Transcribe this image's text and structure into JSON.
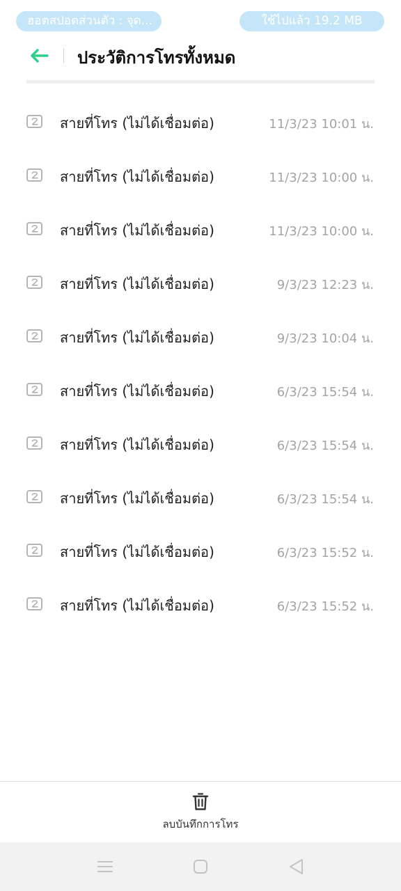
{
  "status_bar": {
    "left_pill": "ฮอตสปอตส่วนตัว : จุด...",
    "right_pill": "ใช้ไปแล้ว 19.2 MB"
  },
  "header": {
    "title": "ประวัติการโทรทั้งหมด",
    "back_icon": "arrow-left-icon",
    "accent_color": "#2ecf8b"
  },
  "calls": [
    {
      "label": "สายที่โทร (ไม่ได้เชื่อมต่อ)",
      "time": "11/3/23 10:01 น."
    },
    {
      "label": "สายที่โทร (ไม่ได้เชื่อมต่อ)",
      "time": "11/3/23 10:00 น."
    },
    {
      "label": "สายที่โทร (ไม่ได้เชื่อมต่อ)",
      "time": "11/3/23 10:00 น."
    },
    {
      "label": "สายที่โทร (ไม่ได้เชื่อมต่อ)",
      "time": "9/3/23 12:23 น."
    },
    {
      "label": "สายที่โทร (ไม่ได้เชื่อมต่อ)",
      "time": "9/3/23 10:04 น."
    },
    {
      "label": "สายที่โทร (ไม่ได้เชื่อมต่อ)",
      "time": "6/3/23 15:54 น."
    },
    {
      "label": "สายที่โทร (ไม่ได้เชื่อมต่อ)",
      "time": "6/3/23 15:54 น."
    },
    {
      "label": "สายที่โทร (ไม่ได้เชื่อมต่อ)",
      "time": "6/3/23 15:54 น."
    },
    {
      "label": "สายที่โทร (ไม่ได้เชื่อมต่อ)",
      "time": "6/3/23 15:52 น."
    },
    {
      "label": "สายที่โทร (ไม่ได้เชื่อมต่อ)",
      "time": "6/3/23 15:52 น."
    }
  ],
  "call_icon": "sim-2-icon",
  "bottom_action": {
    "label": "ลบบันทึกการโทร",
    "icon": "trash-icon"
  },
  "nav_bar": {
    "menu_icon": "menu-lines-icon",
    "home_icon": "home-square-icon",
    "back_icon": "back-triangle-icon"
  }
}
